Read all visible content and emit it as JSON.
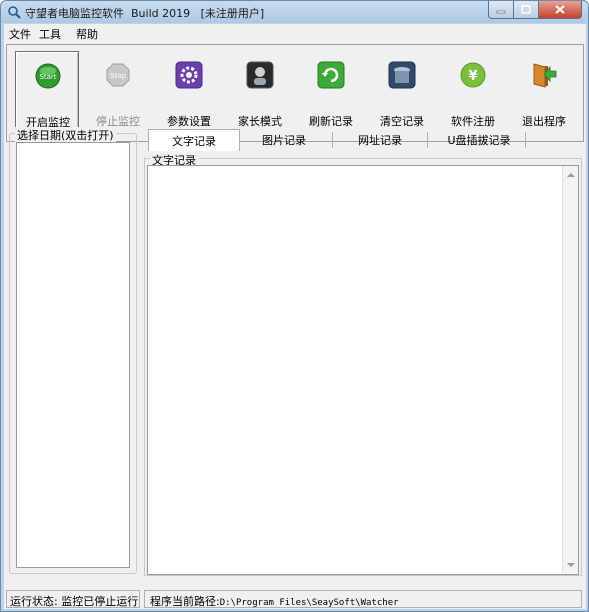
{
  "window": {
    "title": "守望者电脑监控软件  Build 2019   [未注册用户]"
  },
  "menu": [
    "文件",
    "工具",
    "帮助"
  ],
  "toolbar": [
    {
      "label": "开启监控",
      "icon": "start-icon",
      "state": "active"
    },
    {
      "label": "停止监控",
      "icon": "stop-icon",
      "state": "disabled"
    },
    {
      "label": "参数设置",
      "icon": "settings-icon",
      "state": "normal"
    },
    {
      "label": "家长模式",
      "icon": "parent-mode-icon",
      "state": "normal"
    },
    {
      "label": "刷新记录",
      "icon": "refresh-icon",
      "state": "normal"
    },
    {
      "label": "清空记录",
      "icon": "trash-icon",
      "state": "normal"
    },
    {
      "label": "软件注册",
      "icon": "yen-icon",
      "state": "normal"
    },
    {
      "label": "退出程序",
      "icon": "exit-icon",
      "state": "normal"
    }
  ],
  "date_panel": {
    "legend": "选择日期(双击打开)"
  },
  "tabs": [
    "文字记录",
    "图片记录",
    "网址记录",
    "U盘插拔记录"
  ],
  "active_tab": "文字记录",
  "text_panel": {
    "legend": "文字记录"
  },
  "status": {
    "left": "运行状态: 监控已停止运行",
    "path_label": "程序当前路径:",
    "path_value": "D:\\Program Files\\SeaySoft\\Watcher"
  },
  "colors": {
    "titlebar": "#bcd3ea",
    "close_button": "#c7432c",
    "start_green": "#2e9d2e",
    "settings_purple": "#6a3fb0",
    "refresh_green": "#3aaa3a",
    "yen_green": "#7cbf3a",
    "exit_orange": "#d8872a"
  }
}
